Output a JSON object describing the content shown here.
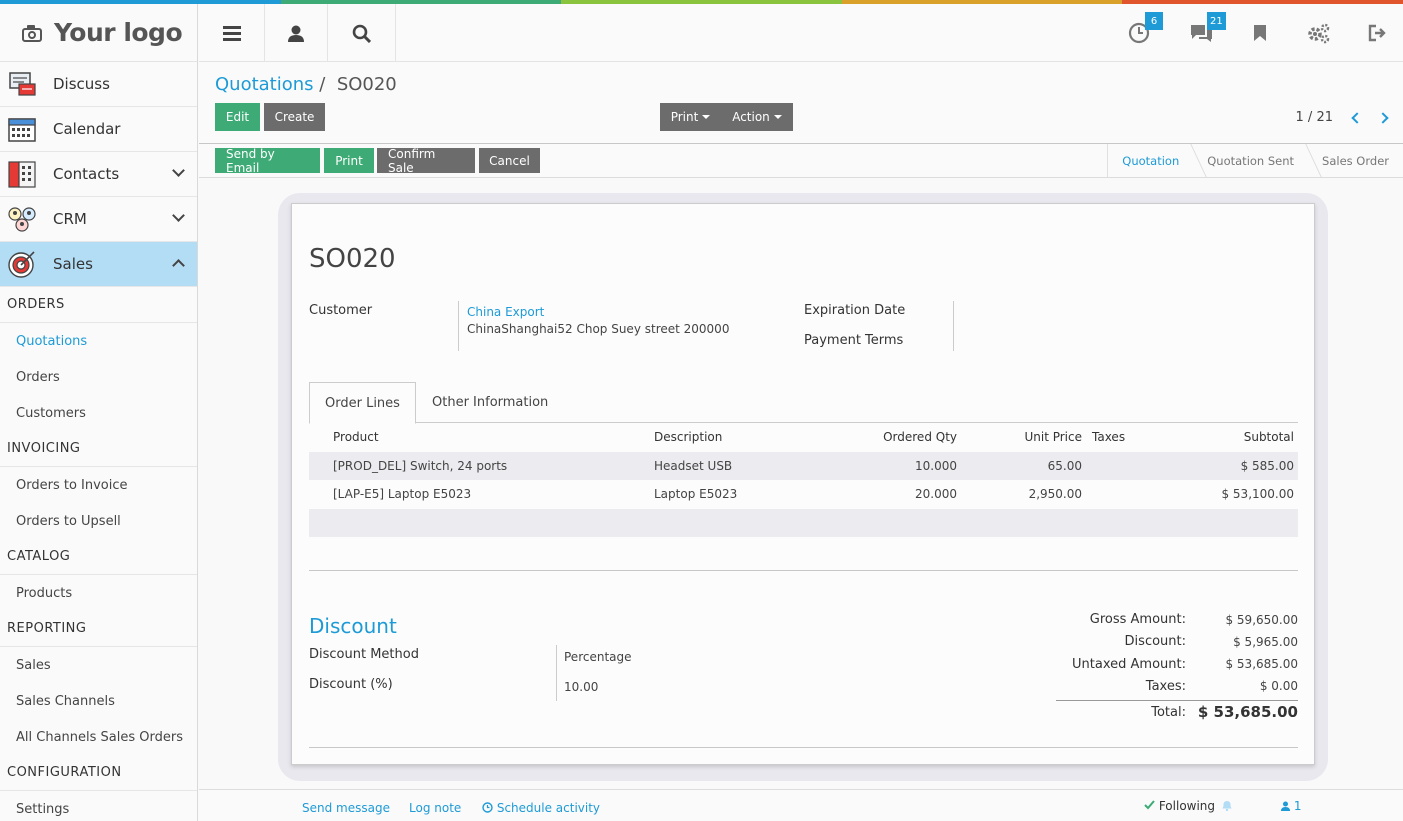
{
  "colors": {
    "bar": [
      "#1e9bd6",
      "#3eab76",
      "#8ac43f",
      "#e8a13a",
      "#e0552c"
    ],
    "accent": "#1e9bd6",
    "primary_button": "#3eab76",
    "secondary_button": "#6c6c6c"
  },
  "logo": {
    "text": "Your logo"
  },
  "sidebar": {
    "apps": [
      {
        "label": "Discuss",
        "icon": "discuss-icon"
      },
      {
        "label": "Calendar",
        "icon": "calendar-icon"
      },
      {
        "label": "Contacts",
        "icon": "contacts-icon"
      },
      {
        "label": "CRM",
        "icon": "crm-icon"
      },
      {
        "label": "Sales",
        "icon": "sales-target-icon"
      }
    ],
    "sections": {
      "orders": "ORDERS",
      "invoicing": "INVOICING",
      "catalog": "CATALOG",
      "reporting": "REPORTING",
      "configuration": "CONFIGURATION"
    },
    "items": {
      "quotations": "Quotations",
      "orders": "Orders",
      "customers": "Customers",
      "orders_to_invoice": "Orders to Invoice",
      "orders_to_upsell": "Orders to Upsell",
      "products": "Products",
      "sales": "Sales",
      "sales_channels": "Sales Channels",
      "all_channels": "All Channels Sales Orders",
      "settings": "Settings"
    }
  },
  "topnav": {
    "activities_badge": "6",
    "messages_badge": "21"
  },
  "breadcrumb": {
    "parent": "Quotations",
    "separator": "/",
    "current": "SO020"
  },
  "buttons": {
    "edit": "Edit",
    "create": "Create",
    "print_menu": "Print",
    "action_menu": "Action",
    "send_email": "Send by Email",
    "print": "Print",
    "confirm_sale": "Confirm Sale",
    "cancel": "Cancel"
  },
  "pager": {
    "value": "1 / 21"
  },
  "statusbar": [
    "Quotation",
    "Quotation Sent",
    "Sales Order"
  ],
  "form": {
    "title": "SO020",
    "customer_label": "Customer",
    "customer_name": "China Export",
    "customer_address": "ChinaShanghai52 Chop Suey street 200000",
    "expiration_label": "Expiration Date",
    "payment_terms_label": "Payment Terms"
  },
  "tabs": [
    "Order Lines",
    "Other Information"
  ],
  "order_lines": {
    "headers": [
      "Product",
      "Description",
      "Ordered Qty",
      "Unit Price",
      "Taxes",
      "Subtotal"
    ],
    "rows": [
      [
        "[PROD_DEL] Switch, 24 ports",
        "Headset USB",
        "10.000",
        "65.00",
        "",
        "$ 585.00"
      ],
      [
        "[LAP-E5] Laptop E5023",
        "Laptop E5023",
        "20.000",
        "2,950.00",
        "",
        "$ 53,100.00"
      ]
    ]
  },
  "discount": {
    "title": "Discount",
    "method_label": "Discount Method",
    "method_value": "Percentage",
    "percent_label": "Discount (%)",
    "percent_value": "10.00"
  },
  "totals": {
    "gross_label": "Gross Amount:",
    "gross_value": "$ 59,650.00",
    "discount_label": "Discount:",
    "discount_value": "$ 5,965.00",
    "untaxed_label": "Untaxed Amount:",
    "untaxed_value": "$ 53,685.00",
    "taxes_label": "Taxes:",
    "taxes_value": "$ 0.00",
    "total_label": "Total:",
    "total_value": "$ 53,685.00"
  },
  "chatter": {
    "send_message": "Send message",
    "log_note": "Log note",
    "schedule_activity": "Schedule activity",
    "following": "Following",
    "followers": "1"
  }
}
